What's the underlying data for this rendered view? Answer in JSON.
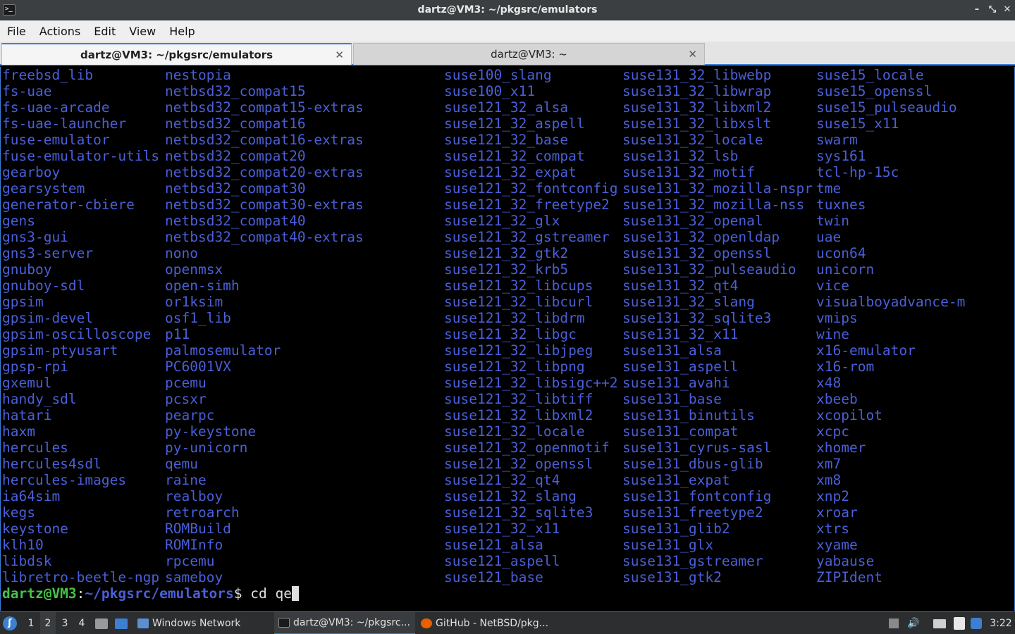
{
  "window": {
    "title": "dartz@VM3: ~/pkgsrc/emulators",
    "app_icon": ">_",
    "minimize": "–",
    "maximize": "⤡",
    "close": "✕"
  },
  "menu": [
    "File",
    "Actions",
    "Edit",
    "View",
    "Help"
  ],
  "tabs": [
    {
      "label": "dartz@VM3: ~/pkgsrc/emulators",
      "close": "✕",
      "active": true
    },
    {
      "label": "dartz@VM3: ~",
      "close": "✕",
      "active": false
    }
  ],
  "terminal": {
    "columns": [
      [
        "freebsd_lib",
        "fs-uae",
        "fs-uae-arcade",
        "fs-uae-launcher",
        "fuse-emulator",
        "fuse-emulator-utils",
        "gearboy",
        "gearsystem",
        "generator-cbiere",
        "gens",
        "gns3-gui",
        "gns3-server",
        "gnuboy",
        "gnuboy-sdl",
        "gpsim",
        "gpsim-devel",
        "gpsim-oscilloscope",
        "gpsim-ptyusart",
        "gpsp-rpi",
        "gxemul",
        "handy_sdl",
        "hatari",
        "haxm",
        "hercules",
        "hercules4sdl",
        "hercules-images",
        "ia64sim",
        "kegs",
        "keystone",
        "klh10",
        "libdsk",
        "libretro-beetle-ngp"
      ],
      [
        "nestopia",
        "netbsd32_compat15",
        "netbsd32_compat15-extras",
        "netbsd32_compat16",
        "netbsd32_compat16-extras",
        "netbsd32_compat20",
        "netbsd32_compat20-extras",
        "netbsd32_compat30",
        "netbsd32_compat30-extras",
        "netbsd32_compat40",
        "netbsd32_compat40-extras",
        "nono",
        "openmsx",
        "open-simh",
        "or1ksim",
        "osf1_lib",
        "p11",
        "palmosemulator",
        "PC6001VX",
        "pcemu",
        "pcsxr",
        "pearpc",
        "py-keystone",
        "py-unicorn",
        "qemu",
        "raine",
        "realboy",
        "retroarch",
        "ROMBuild",
        "ROMInfo",
        "rpcemu",
        "sameboy"
      ],
      [
        "suse100_slang",
        "suse100_x11",
        "suse121_32_alsa",
        "suse121_32_aspell",
        "suse121_32_base",
        "suse121_32_compat",
        "suse121_32_expat",
        "suse121_32_fontconfig",
        "suse121_32_freetype2",
        "suse121_32_glx",
        "suse121_32_gstreamer",
        "suse121_32_gtk2",
        "suse121_32_krb5",
        "suse121_32_libcups",
        "suse121_32_libcurl",
        "suse121_32_libdrm",
        "suse121_32_libgc",
        "suse121_32_libjpeg",
        "suse121_32_libpng",
        "suse121_32_libsigc++2",
        "suse121_32_libtiff",
        "suse121_32_libxml2",
        "suse121_32_locale",
        "suse121_32_openmotif",
        "suse121_32_openssl",
        "suse121_32_qt4",
        "suse121_32_slang",
        "suse121_32_sqlite3",
        "suse121_32_x11",
        "suse121_alsa",
        "suse121_aspell",
        "suse121_base"
      ],
      [
        "suse131_32_libwebp",
        "suse131_32_libwrap",
        "suse131_32_libxml2",
        "suse131_32_libxslt",
        "suse131_32_locale",
        "suse131_32_lsb",
        "suse131_32_motif",
        "suse131_32_mozilla-nspr",
        "suse131_32_mozilla-nss",
        "suse131_32_openal",
        "suse131_32_openldap",
        "suse131_32_openssl",
        "suse131_32_pulseaudio",
        "suse131_32_qt4",
        "suse131_32_slang",
        "suse131_32_sqlite3",
        "suse131_32_x11",
        "suse131_alsa",
        "suse131_aspell",
        "suse131_avahi",
        "suse131_base",
        "suse131_binutils",
        "suse131_compat",
        "suse131_cyrus-sasl",
        "suse131_dbus-glib",
        "suse131_expat",
        "suse131_fontconfig",
        "suse131_freetype2",
        "suse131_glib2",
        "suse131_glx",
        "suse131_gstreamer",
        "suse131_gtk2"
      ],
      [
        "suse15_locale",
        "suse15_openssl",
        "suse15_pulseaudio",
        "suse15_x11",
        "swarm",
        "sys161",
        "tcl-hp-15c",
        "tme",
        "tuxnes",
        "twin",
        "uae",
        "ucon64",
        "unicorn",
        "vice",
        "visualboyadvance-m",
        "vmips",
        "wine",
        "x16-emulator",
        "x16-rom",
        "x48",
        "xbeeb",
        "xcopilot",
        "xcpc",
        "xhomer",
        "xm7",
        "xm8",
        "xnp2",
        "xroar",
        "xtrs",
        "xyame",
        "yabause",
        "ZIPIdent"
      ]
    ],
    "prompt": {
      "user_host": "dartz@VM3",
      "separator": ":",
      "path": "~/pkgsrc/emulators",
      "symbol": "$",
      "command": " cd qe"
    },
    "colors": {
      "filename": "#4a5fd8",
      "prompt_user": "#43c44a",
      "text": "#e0e0e0",
      "background": "#000000"
    }
  },
  "taskbar": {
    "workspaces": [
      "1",
      "2",
      "3",
      "4"
    ],
    "active_workspace": "2",
    "network_task": "Windows Network",
    "tasks": [
      "dartz@VM3: ~/pkgsrc...",
      "GitHub - NetBSD/pkg..."
    ],
    "clock": "3:22"
  }
}
